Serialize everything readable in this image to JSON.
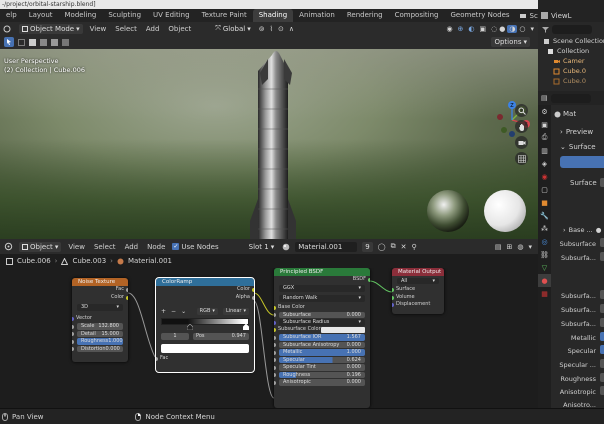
{
  "titlebar": {
    "text": "-/project/orbital-starship.blend]"
  },
  "menu": {
    "items": [
      "elp",
      "Layout",
      "Modeling",
      "Sculpting",
      "UV Editing",
      "Texture Paint",
      "Shading",
      "Animation",
      "Rendering",
      "Compositing",
      "Geometry Nodes"
    ],
    "active_index": 6,
    "scene_label": "Scene",
    "viewlayer_label": "ViewL"
  },
  "viewport_header": {
    "mode": "Object Mode",
    "menus": [
      "View",
      "Select",
      "Add",
      "Object"
    ],
    "orientation": "Global",
    "options_label": "Options"
  },
  "viewport": {
    "perspective_label": "User Perspective",
    "collection_label": "(2) Collection | Cube.006",
    "gizmo": {
      "x": "X",
      "y": "Y",
      "z": "Z"
    }
  },
  "outliner": {
    "items": [
      {
        "label": "Scene Collection"
      },
      {
        "label": "Collection"
      },
      {
        "label": "Camer"
      },
      {
        "label": "Cube.0"
      },
      {
        "label": "Cube.0"
      }
    ]
  },
  "node_header": {
    "editor_type": "Object",
    "menus": [
      "View",
      "Select",
      "Add",
      "Node"
    ],
    "use_nodes_label": "Use Nodes",
    "slot_label": "Slot 1",
    "material": "Material.001",
    "users": "9"
  },
  "breadcrumb": {
    "items": [
      "Cube.006",
      "Cube.003",
      "Material.001"
    ]
  },
  "nodes": {
    "noise": {
      "title": "Noise Texture",
      "outputs": [
        "Fac",
        "Color"
      ],
      "dim": "3D",
      "vector": "Vector",
      "fields": [
        {
          "label": "Scale",
          "value": "132.800"
        },
        {
          "label": "Detail",
          "value": "15.000"
        },
        {
          "label": "Roughness",
          "value": "1.000"
        },
        {
          "label": "Distortion",
          "value": "0.000"
        }
      ]
    },
    "ramp": {
      "title": "ColorRamp",
      "outputs": [
        "Color",
        "Alpha"
      ],
      "mode": "RGB",
      "interp": "Linear",
      "index": "1",
      "pos_label": "Pos",
      "pos_value": "0.947",
      "input": "Fac"
    },
    "bsdf": {
      "title": "Principled BSDF",
      "output": "BSDF",
      "dist": "GGX",
      "sss": "Random Walk",
      "rows": [
        {
          "label": "Base Color",
          "value": "",
          "type": "socket"
        },
        {
          "label": "Subsurface",
          "value": "0.000",
          "type": "field"
        },
        {
          "label": "Subsurface Radius",
          "value": "",
          "type": "drop"
        },
        {
          "label": "Subsurface Color",
          "value": "",
          "type": "color"
        },
        {
          "label": "Subsurface IOR",
          "value": "1.567",
          "type": "blue"
        },
        {
          "label": "Subsurface Anisotropy",
          "value": "0.000",
          "type": "field"
        },
        {
          "label": "Metallic",
          "value": "1.000",
          "type": "blue"
        },
        {
          "label": "Specular",
          "value": "0.624",
          "type": "blue"
        },
        {
          "label": "Specular Tint",
          "value": "0.000",
          "type": "field"
        },
        {
          "label": "Roughness",
          "value": "0.196",
          "type": "blue"
        },
        {
          "label": "Anisotropic",
          "value": "0.000",
          "type": "field"
        }
      ]
    },
    "output": {
      "title": "Material Output",
      "target": "All",
      "inputs": [
        "Surface",
        "Volume",
        "Displacement"
      ]
    }
  },
  "properties": {
    "material_name": "Mat",
    "preview_label": "Preview",
    "surface_label": "Surface",
    "surface_field": "Surface",
    "base_label": "Base ...",
    "labels": [
      "Subsurface",
      "Subsurfa...",
      "Subsurfa...",
      "Subsurfa...",
      "Subsurfa...",
      "Metallic",
      "Specular",
      "Specular ...",
      "Roughness",
      "Anisotropic",
      "Anisotro..."
    ]
  },
  "status": {
    "pan_label": "Pan View",
    "context_label": "Node Context Menu"
  },
  "colors": {
    "accent": "#4772b3",
    "active_tab": "#3d3d3d",
    "noise_header": "#b26325",
    "ramp_header": "#2f6f9a",
    "bsdf_header": "#2a7a3a",
    "output_header": "#8b2e3a"
  }
}
